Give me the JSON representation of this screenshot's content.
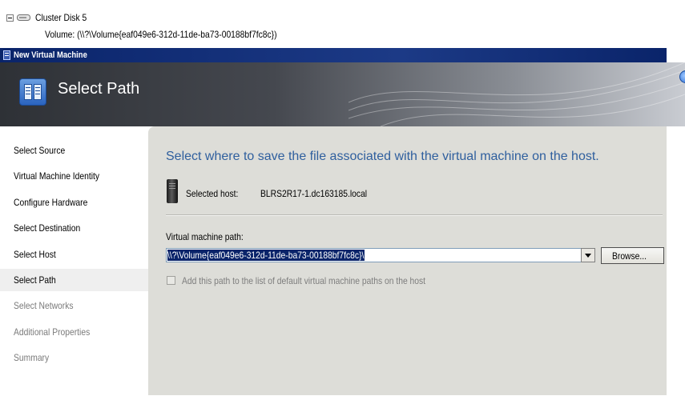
{
  "tree": {
    "disk_label": "Cluster Disk 5",
    "volume_label": "Volume: (\\\\?\\Volume{eaf049e6-312d-11de-ba73-00188bf7fc8c})"
  },
  "window": {
    "title": "New Virtual Machine"
  },
  "header": {
    "title": "Select Path"
  },
  "sidebar": {
    "items": [
      {
        "label": "Select Source",
        "state": "normal"
      },
      {
        "label": "Virtual Machine Identity",
        "state": "normal"
      },
      {
        "label": "Configure Hardware",
        "state": "normal"
      },
      {
        "label": "Select Destination",
        "state": "normal"
      },
      {
        "label": "Select Host",
        "state": "normal"
      },
      {
        "label": "Select Path",
        "state": "current"
      },
      {
        "label": "Select Networks",
        "state": "disabled"
      },
      {
        "label": "Additional Properties",
        "state": "disabled"
      },
      {
        "label": "Summary",
        "state": "disabled"
      }
    ]
  },
  "main": {
    "heading": "Select where to save the file associated with the virtual machine on the host.",
    "host_label": "Selected host:",
    "host_value": "BLRS2R17-1.dc163185.local",
    "path_label": "Virtual machine path:",
    "path_value": "\\\\?\\Volume{eaf049e6-312d-11de-ba73-00188bf7fc8c}\\",
    "browse_label": "Browse...",
    "checkbox_label": "Add this path to the list of default virtual machine paths on the host",
    "checkbox_checked": false
  },
  "colors": {
    "title_bar": "#0a246a",
    "heading_text": "#2f5f9e",
    "panel_background": "#ddddd8",
    "selection": "#0a246a"
  }
}
